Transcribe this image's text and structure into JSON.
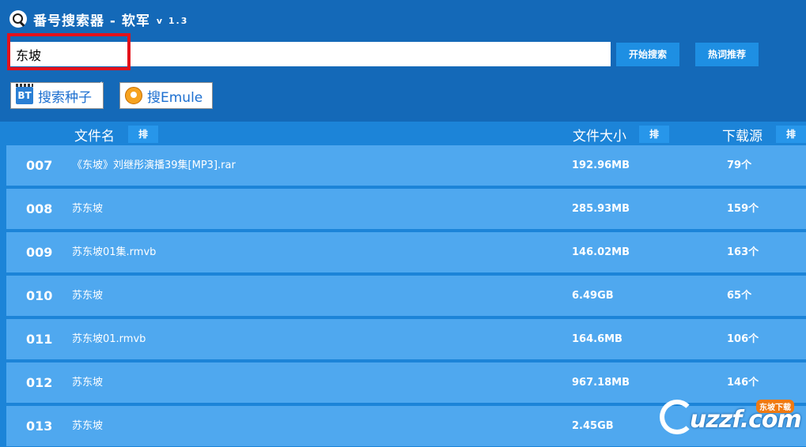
{
  "window": {
    "title": "番号搜索器 - 软军",
    "version": "v 1.3"
  },
  "search": {
    "value": "东坡",
    "start_label": "开始搜索",
    "hot_label": "热词推荐"
  },
  "sources": {
    "bt_icon_text": "BT",
    "bt_label": "搜索种子",
    "emule_label": "搜Emule"
  },
  "table": {
    "headers": {
      "name": "文件名",
      "size": "文件大小",
      "source": "下载源",
      "sort_label": "排"
    },
    "rows": [
      {
        "num": "007",
        "name": "《东坡》刘继彤演播39集[MP3].rar",
        "size": "192.96MB",
        "source": "79个"
      },
      {
        "num": "008",
        "name": "苏东坡",
        "size": "285.93MB",
        "source": "159个"
      },
      {
        "num": "009",
        "name": "苏东坡01集.rmvb",
        "size": "146.02MB",
        "source": "163个"
      },
      {
        "num": "010",
        "name": "苏东坡",
        "size": "6.49GB",
        "source": "65个"
      },
      {
        "num": "011",
        "name": "苏东坡01.rmvb",
        "size": "164.6MB",
        "source": "106个"
      },
      {
        "num": "012",
        "name": "苏东坡",
        "size": "967.18MB",
        "source": "146个"
      },
      {
        "num": "013",
        "name": "苏东坡",
        "size": "2.45GB",
        "source": ""
      }
    ]
  },
  "watermark": {
    "text": "uzzf.com",
    "badge": "东坡下载"
  },
  "colors": {
    "background": "#1469b8",
    "row": "#4fa8ef",
    "button": "#1e8fe3",
    "highlight": "#e3121b"
  }
}
